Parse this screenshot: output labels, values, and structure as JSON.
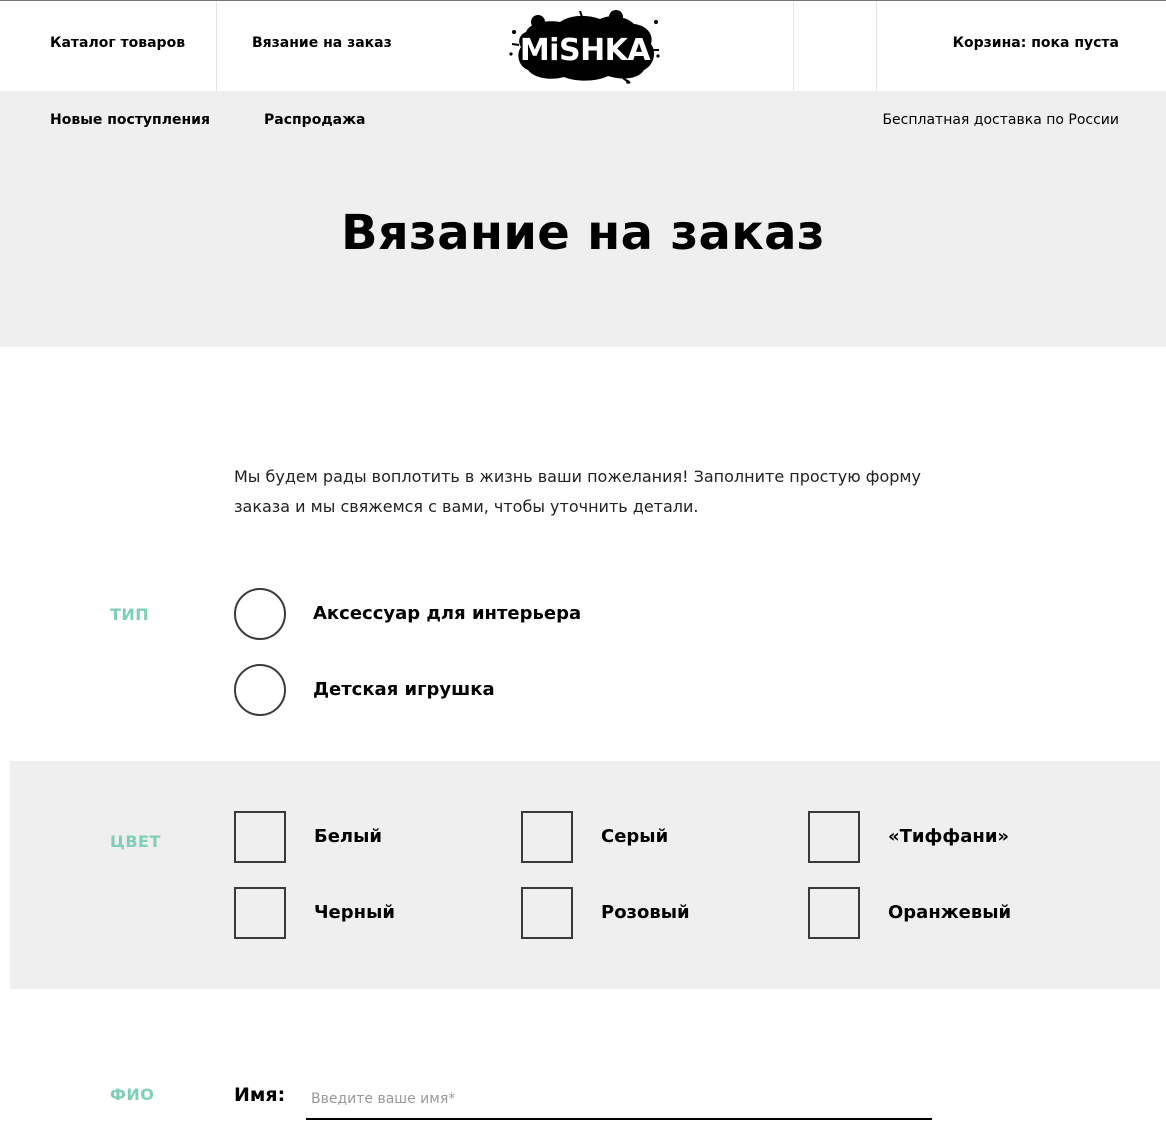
{
  "header": {
    "nav": {
      "catalog": "Каталог товаров",
      "custom_knitting": "Вязание на заказ"
    },
    "logo_text": "MiSHKA",
    "cart": "Корзина: пока пуста"
  },
  "subnav": {
    "new_arrivals": "Новые поступления",
    "sale": "Распродажа",
    "delivery": "Бесплатная доставка по России"
  },
  "page": {
    "title": "Вязание на заказ",
    "intro": "Мы будем рады воплотить в жизнь ваши пожелания! Заполните простую форму заказа и мы свяжемся с вами, чтобы уточнить детали."
  },
  "form": {
    "type_section": {
      "label": "ТИП",
      "options": [
        {
          "label": "Аксессуар для интерьера",
          "checked": false
        },
        {
          "label": "Детская игрушка",
          "checked": false
        }
      ]
    },
    "color_section": {
      "label": "ЦВЕТ",
      "options": [
        {
          "label": "Белый",
          "checked": false
        },
        {
          "label": "Серый",
          "checked": false
        },
        {
          "label": "«Тиффани»",
          "checked": false
        },
        {
          "label": "Черный",
          "checked": false
        },
        {
          "label": "Розовый",
          "checked": false
        },
        {
          "label": "Оранжевый",
          "checked": false
        }
      ]
    },
    "name_section": {
      "label": "ФИО",
      "first_name_label": "Имя:",
      "first_name_placeholder": "Введите ваше имя*",
      "first_name_value": ""
    }
  },
  "colors": {
    "accent": "#7fcfb8",
    "band": "#efefef",
    "text": "#000000"
  }
}
